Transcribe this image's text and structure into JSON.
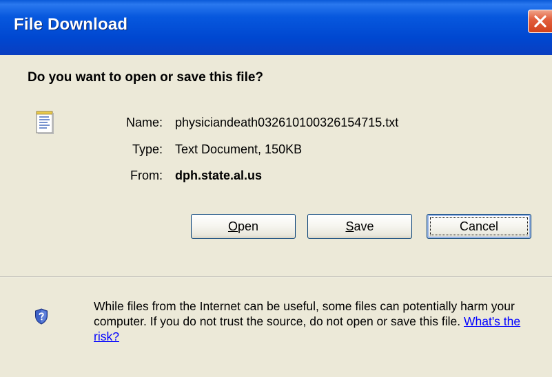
{
  "window": {
    "title": "File Download"
  },
  "dialog": {
    "question": "Do you want to open or save this file?",
    "name_label": "Name:",
    "name_value": "physiciandeath032610100326154715.txt",
    "type_label": "Type:",
    "type_value": "Text Document, 150KB",
    "from_label": "From:",
    "from_value": "dph.state.al.us"
  },
  "buttons": {
    "open_mnemonic": "O",
    "open_rest": "pen",
    "save_mnemonic": "S",
    "save_rest": "ave",
    "cancel_label": "Cancel"
  },
  "warning": {
    "text": "While files from the Internet can be useful, some files can potentially harm your computer. If you do not trust the source, do not open or save this file.",
    "link": "What's the risk?"
  },
  "icons": {
    "file": "text-file-icon",
    "shield": "security-shield-icon",
    "close": "close-icon"
  },
  "colors": {
    "titlebar": "#0054e3",
    "close_button": "#e2603e",
    "dialog_background": "#ece9d8",
    "link": "#0000ff"
  }
}
